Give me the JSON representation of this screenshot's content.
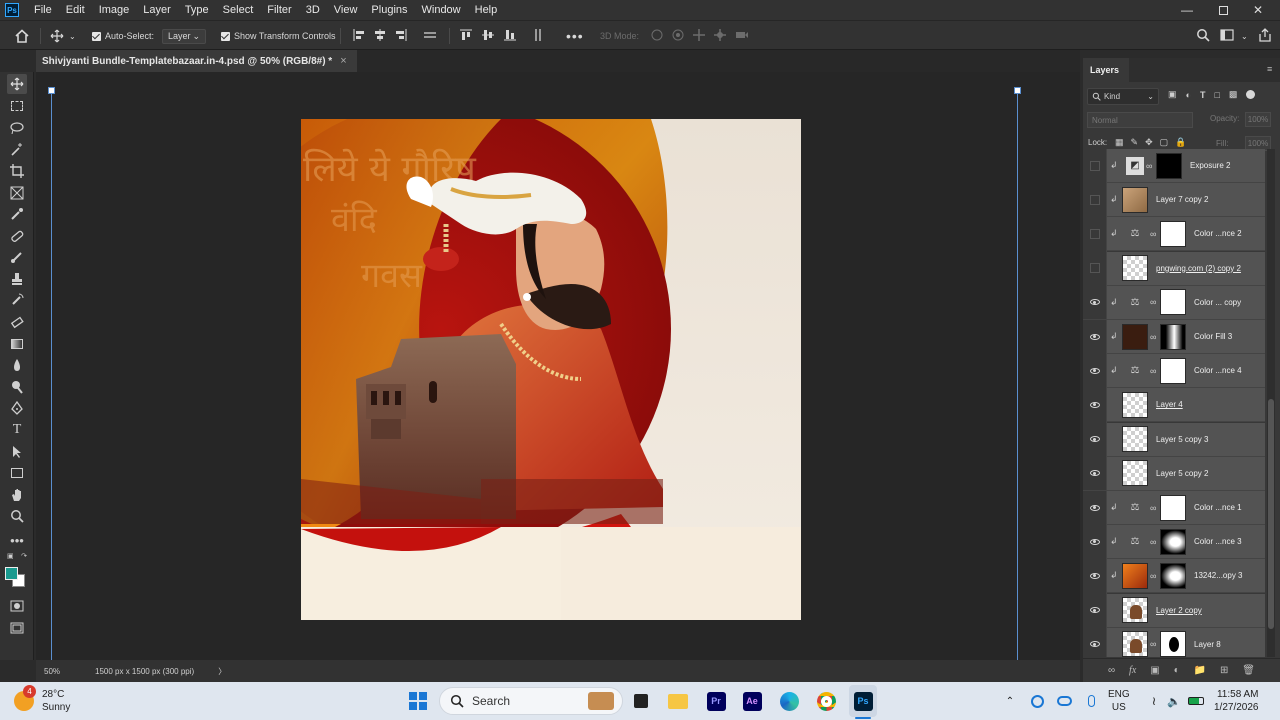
{
  "app": {
    "icon_text": "Ps",
    "menu": [
      "File",
      "Edit",
      "Image",
      "Layer",
      "Type",
      "Select",
      "Filter",
      "3D",
      "View",
      "Plugins",
      "Window",
      "Help"
    ],
    "window_controls": [
      "minimize-icon",
      "restore-icon",
      "close-icon"
    ]
  },
  "options_bar": {
    "auto_select_label": "Auto-Select:",
    "auto_select_value": "Layer",
    "show_transform_label": "Show Transform Controls",
    "mode_3d_label": "3D Mode:"
  },
  "document": {
    "tab_title": "Shivjyanti Bundle-Templatebazaar.in-4.psd @ 50% (RGB/8#) *",
    "close_glyph": "×",
    "zoom": "50%",
    "dimensions": "1500 px x 1500 px (300 ppi)",
    "status_arrow": "〉",
    "art_text": [
      "लिये ये गौरिष",
      "वंदि",
      "गवस"
    ]
  },
  "layers_panel": {
    "tab_label": "Layers",
    "filter_label": "Kind",
    "blend_mode": "Normal",
    "opacity_label": "Opacity:",
    "opacity_value": "100%",
    "lock_label": "Lock:",
    "fill_label": "Fill:",
    "fill_value": "100%",
    "layers": [
      {
        "name": "Exposure 2",
        "visible": false,
        "clipped": true,
        "thumb": "adjust",
        "mask": "black"
      },
      {
        "name": "Layer 7 copy 2",
        "visible": false,
        "clipped": true,
        "thumb": "tan",
        "mask": ""
      },
      {
        "name": "Color ...nce 2",
        "visible": false,
        "clipped": true,
        "thumb": "balance",
        "mask": "white"
      },
      {
        "name": "pngwing.com (2) copy 2",
        "visible": false,
        "clipped": false,
        "thumb": "checker",
        "mask": "",
        "underline": true
      },
      {
        "name": "Color ... copy",
        "visible": true,
        "clipped": true,
        "thumb": "balance",
        "mask": "white"
      },
      {
        "name": "Color Fill 3",
        "visible": true,
        "clipped": true,
        "thumb": "darkbrown",
        "mask": "gradient"
      },
      {
        "name": "Color ...nce 4",
        "visible": true,
        "clipped": true,
        "thumb": "balance",
        "mask": "white"
      },
      {
        "name": "Layer 4",
        "visible": true,
        "clipped": false,
        "thumb": "checker",
        "mask": "",
        "underline": true
      },
      {
        "name": "Layer 5 copy 3",
        "visible": true,
        "clipped": false,
        "thumb": "checker",
        "mask": ""
      },
      {
        "name": "Layer 5 copy 2",
        "visible": true,
        "clipped": false,
        "thumb": "checker",
        "mask": ""
      },
      {
        "name": "Color ...nce 1",
        "visible": true,
        "clipped": true,
        "thumb": "balance",
        "mask": "white"
      },
      {
        "name": "Color ...nce 3",
        "visible": true,
        "clipped": true,
        "thumb": "balance",
        "mask": "blur"
      },
      {
        "name": "13242...opy 3",
        "visible": true,
        "clipped": true,
        "thumb": "orange",
        "mask": "blur"
      },
      {
        "name": "Layer 2 copy",
        "visible": true,
        "clipped": false,
        "thumb": "portrait",
        "mask": "",
        "underline": true
      },
      {
        "name": "Layer 8",
        "visible": true,
        "clipped": false,
        "thumb": "portrait",
        "mask": "shape"
      }
    ]
  },
  "taskbar": {
    "weather_temp": "28°C",
    "weather_desc": "Sunny",
    "weather_badge": "4",
    "search_placeholder": "Search",
    "language": "ENG",
    "region": "US",
    "time": "11:58 AM",
    "date": "1/27/2026"
  },
  "colors": {
    "foreground": "#1a9a8f",
    "background": "#ffffff",
    "accent_blue": "#31a8ff"
  }
}
